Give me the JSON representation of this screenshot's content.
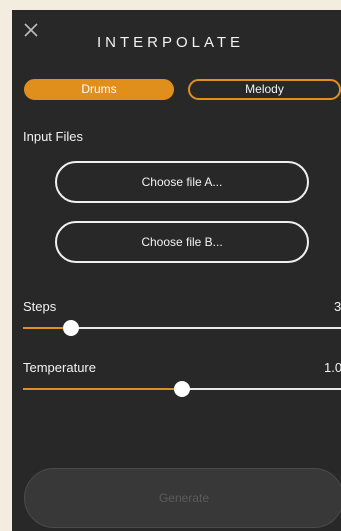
{
  "header": {
    "title": "INTERPOLATE",
    "close_icon": "close-icon"
  },
  "mode_toggle": {
    "options": [
      "Drums",
      "Melody"
    ],
    "selected": "Drums"
  },
  "inputs": {
    "section_label": "Input Files",
    "file_a_label": "Choose file A...",
    "file_b_label": "Choose file B..."
  },
  "sliders": {
    "steps": {
      "label": "Steps",
      "value_text": "3",
      "level": 0.15
    },
    "temperature": {
      "label": "Temperature",
      "value_text": "1.0",
      "level": 0.5
    }
  },
  "generate": {
    "label": "Generate",
    "enabled": false
  },
  "colors": {
    "accent": "#e08f1c",
    "panel_background": "#282828",
    "page_background": "#f3ede0",
    "disabled_text": "#5b5b5b"
  }
}
